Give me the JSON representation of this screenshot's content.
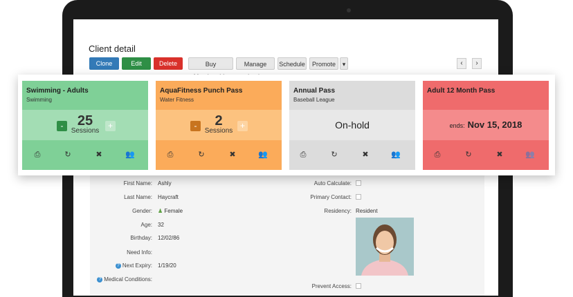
{
  "page": {
    "title": "Client detail"
  },
  "toolbar": {
    "clone": "Clone",
    "edit": "Edit",
    "delete": "Delete",
    "buy_membership": "Buy Membership",
    "manage_login": "Manage Login",
    "schedule": "Schedule",
    "promote": "Promote",
    "more": "▾",
    "prev": "‹",
    "next": "›"
  },
  "cards": [
    {
      "name": "Swimming - Adults",
      "category": "Swimming",
      "count": "25",
      "unit": "Sessions",
      "minus": "-",
      "plus": "+",
      "color": "#7fd097"
    },
    {
      "name": "AquaFitness Punch Pass",
      "category": "Water Fitness",
      "count": "2",
      "unit": "Sessions",
      "minus": "-",
      "plus": "+",
      "color": "#fbab5a"
    },
    {
      "name": "Annual Pass",
      "category": "Baseball League",
      "status": "On-hold",
      "color": "#dcdcdc"
    },
    {
      "name": "Adult 12 Month Pass",
      "category": "",
      "ends_label": "ends:",
      "ends_date": "Nov 15, 2018",
      "color": "#ef6b6c"
    }
  ],
  "icons": {
    "print": "print-icon",
    "renew": "refresh-icon",
    "cancel": "close-icon",
    "transfer": "users-icon"
  },
  "client": {
    "first_name_label": "First Name:",
    "first_name": "Ashly",
    "last_name_label": "Last Name:",
    "last_name": "Haycraft",
    "gender_label": "Gender:",
    "gender": "Female",
    "age_label": "Age:",
    "age": "32",
    "birthday_label": "Birthday:",
    "birthday": "12/02/86",
    "need_info_label": "Need Info:",
    "next_expiry_label": "Next Expiry:",
    "next_expiry": "1/19/20",
    "medical_label": "Medical Conditions:",
    "auto_calc_label": "Auto Calculate:",
    "primary_contact_label": "Primary Contact:",
    "residency_label": "Residency:",
    "residency": "Resident",
    "prevent_access_label": "Prevent Access:"
  }
}
